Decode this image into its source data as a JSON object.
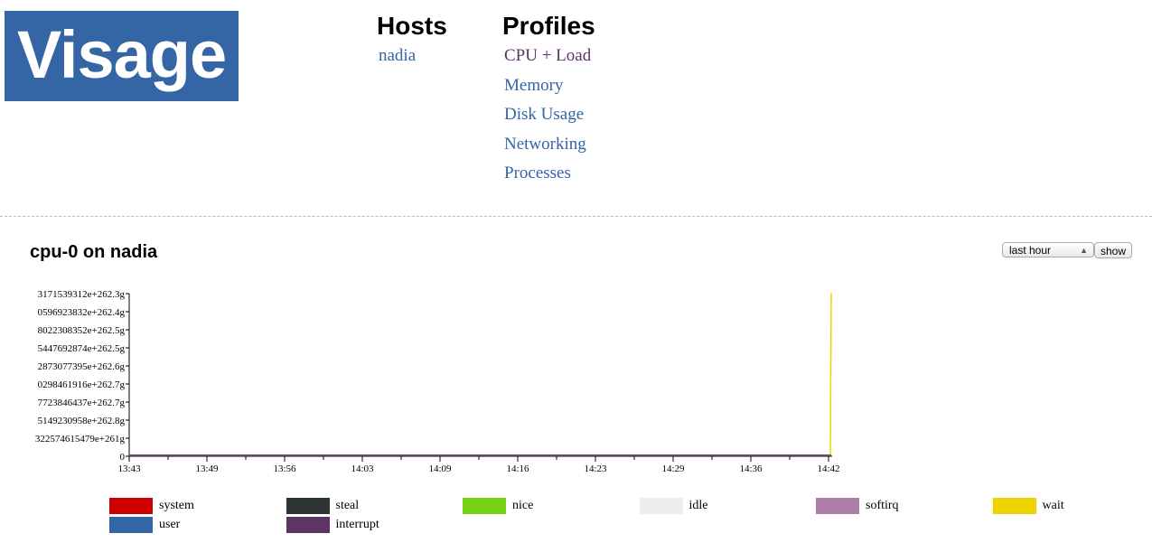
{
  "logo": "Visage",
  "hosts": {
    "heading": "Hosts",
    "items": [
      "nadia"
    ]
  },
  "profiles": {
    "heading": "Profiles",
    "items": [
      "CPU + Load",
      "Memory",
      "Disk Usage",
      "Networking",
      "Processes"
    ]
  },
  "graph_title": "cpu-0 on nadia",
  "range_select": {
    "value": "last hour"
  },
  "show_label": "show",
  "chart_data": {
    "type": "line",
    "x_ticks": [
      "13:43",
      "13:49",
      "13:56",
      "14:03",
      "14:09",
      "14:16",
      "14:23",
      "14:29",
      "14:36",
      "14:42"
    ],
    "y_ticks": [
      "0",
      "322574615479e+261g",
      "5149230958e+262.8g",
      "7723846437e+262.7g",
      "0298461916e+262.7g",
      "2873077395e+262.6g",
      "5447692874e+262.5g",
      "8022308352e+262.5g",
      "0596923832e+262.4g",
      "3171539312e+262.3g"
    ],
    "grid": false,
    "legend_position": "bottom",
    "series": [
      {
        "name": "system",
        "color": "#cc0000",
        "values": [
          0,
          0,
          0,
          0,
          0,
          0,
          0,
          0,
          0,
          0
        ]
      },
      {
        "name": "steal",
        "color": "#2e3436",
        "values": [
          0,
          0,
          0,
          0,
          0,
          0,
          0,
          0,
          0,
          0
        ]
      },
      {
        "name": "nice",
        "color": "#73d216",
        "values": [
          0,
          0,
          0,
          0,
          0,
          0,
          0,
          0,
          0,
          0
        ]
      },
      {
        "name": "idle",
        "color": "#eeeeec",
        "values": [
          0,
          0,
          0,
          0,
          0,
          0,
          0,
          0,
          0,
          0
        ]
      },
      {
        "name": "softirq",
        "color": "#ad7fa8",
        "values": [
          0,
          0,
          0,
          0,
          0,
          0,
          0,
          0,
          0,
          0
        ]
      },
      {
        "name": "wait",
        "color": "#edd400",
        "values": [
          0,
          0,
          0,
          0,
          0,
          0,
          0,
          0,
          0,
          "3171539312e+262.3g"
        ]
      },
      {
        "name": "user",
        "color": "#3465a4",
        "values": [
          0,
          0,
          0,
          0,
          0,
          0,
          0,
          0,
          0,
          0
        ]
      },
      {
        "name": "interrupt",
        "color": "#5c3566",
        "values": [
          0,
          0,
          0,
          0,
          0,
          0,
          0,
          0,
          0,
          0
        ]
      }
    ]
  }
}
